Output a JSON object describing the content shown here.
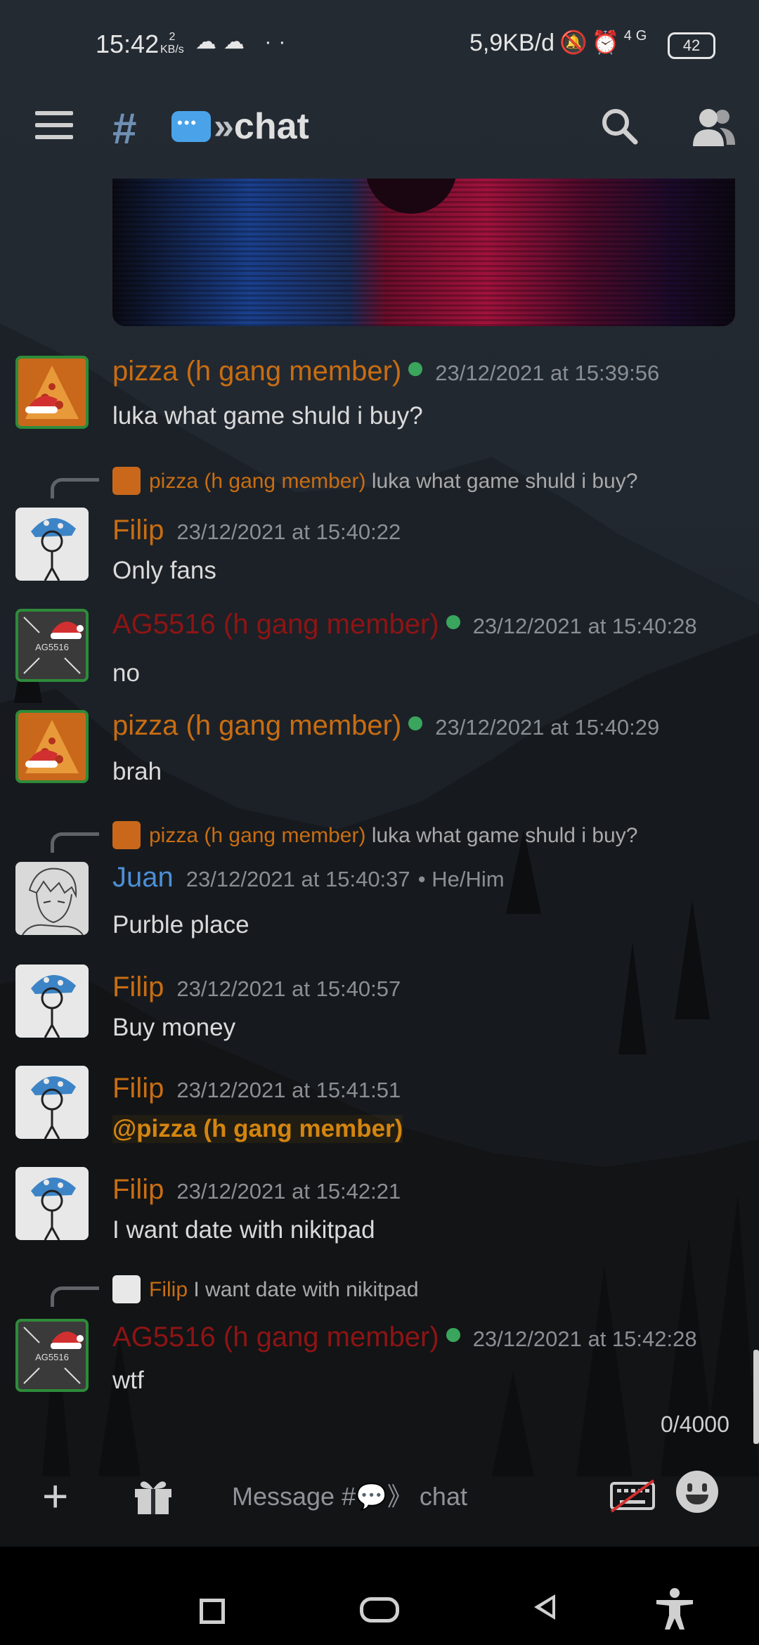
{
  "status_bar": {
    "time": "15:42",
    "speed_small": "2",
    "speed_small_unit": "KB/s",
    "network_speed": "5,9KB/d",
    "network_type": "4G",
    "battery": "42"
  },
  "header": {
    "channel_name": "chat"
  },
  "messages": [
    {
      "author": "pizza (h gang member)",
      "timestamp": "23/12/2021 at 15:39:56",
      "text": "luka what game shuld i buy?",
      "online": true
    },
    {
      "reply_to_author": "pizza (h gang member)",
      "reply_to_text": "luka what game shuld i buy?",
      "author": "Filip",
      "timestamp": "23/12/2021 at 15:40:22",
      "text": "Only fans"
    },
    {
      "author": "AG5516 (h gang member)",
      "avatar_text": "AG5516",
      "timestamp": "23/12/2021 at 15:40:28",
      "text": "no",
      "online": true
    },
    {
      "author": "pizza (h gang member)",
      "timestamp": "23/12/2021 at 15:40:29",
      "text": "brah",
      "online": true
    },
    {
      "reply_to_author": "pizza (h gang member)",
      "reply_to_text": "luka what game shuld i buy?",
      "author": "Juan",
      "timestamp": "23/12/2021 at 15:40:37",
      "pronouns": "• He/Him",
      "text": "Purble place"
    },
    {
      "author": "Filip",
      "timestamp": "23/12/2021 at 15:40:57",
      "text": "Buy money"
    },
    {
      "author": "Filip",
      "timestamp": "23/12/2021 at 15:41:51",
      "text": "@pizza (h gang member)"
    },
    {
      "author": "Filip",
      "timestamp": "23/12/2021 at 15:42:21",
      "text": "I want date with nikitpad"
    },
    {
      "reply_to_author": "Filip",
      "reply_to_text": "I want date with nikitpad",
      "author": "AG5516 (h gang member)",
      "avatar_text": "AG5516",
      "timestamp": "23/12/2021 at 15:42:28",
      "text": "wtf",
      "online": true
    }
  ],
  "composer": {
    "char_counter": "0/4000",
    "placeholder": "Message #💬》 chat"
  },
  "colors": {
    "pizza_role": "#c86d12",
    "ag_role": "#8e1414",
    "juan_name": "#4d8ed6",
    "online": "#3aa55d"
  }
}
